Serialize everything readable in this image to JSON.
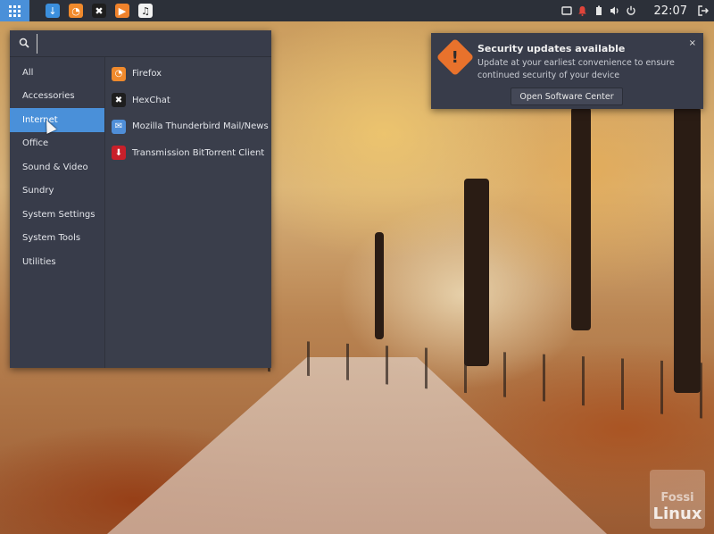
{
  "top_panel": {
    "launchers": [
      {
        "icon": "download-arrow-icon",
        "glyph": "↓",
        "color": "#3b8fdd"
      },
      {
        "icon": "firefox-icon",
        "glyph": "◔",
        "color": "#f08a2c"
      },
      {
        "icon": "hexchat-icon",
        "glyph": "✖",
        "color": "#1e1e1e"
      },
      {
        "icon": "media-player-icon",
        "glyph": "▶",
        "color": "#f0822b"
      },
      {
        "icon": "music-icon",
        "glyph": "♫",
        "color": "#f2f2f2"
      }
    ],
    "tray_icons": [
      "display-icon",
      "bell-icon",
      "battery-icon",
      "volume-icon",
      "power-icon"
    ],
    "clock": "22:07",
    "logout_icon": "logout-icon"
  },
  "app_menu": {
    "search": {
      "placeholder": "",
      "value": ""
    },
    "categories": [
      {
        "label": "All",
        "active": false
      },
      {
        "label": "Accessories",
        "active": false
      },
      {
        "label": "Internet",
        "active": true
      },
      {
        "label": "Office",
        "active": false
      },
      {
        "label": "Sound & Video",
        "active": false
      },
      {
        "label": "Sundry",
        "active": false
      },
      {
        "label": "System Settings",
        "active": false
      },
      {
        "label": "System Tools",
        "active": false
      },
      {
        "label": "Utilities",
        "active": false
      }
    ],
    "apps": [
      {
        "label": "Firefox",
        "icon": "firefox-icon",
        "glyph": "◔",
        "color": "#f08a2c"
      },
      {
        "label": "HexChat",
        "icon": "hexchat-icon",
        "glyph": "✖",
        "color": "#1e1e1e"
      },
      {
        "label": "Mozilla Thunderbird Mail/News",
        "icon": "thunderbird-icon",
        "glyph": "✉",
        "color": "#4f8ed8"
      },
      {
        "label": "Transmission BitTorrent Client",
        "icon": "transmission-icon",
        "glyph": "⬇",
        "color": "#c8202a"
      }
    ]
  },
  "notification": {
    "title": "Security updates available",
    "body": "Update at your earliest convenience to ensure continued security of your device",
    "button": "Open Software Center",
    "close": "×",
    "icon_glyph": "!"
  },
  "watermark": {
    "top": "Fossi",
    "bottom": "Linux"
  },
  "colors": {
    "panel": "#2c3039",
    "menu": "#383c4a",
    "accent": "#4a90d9",
    "warning": "#e8722c"
  }
}
